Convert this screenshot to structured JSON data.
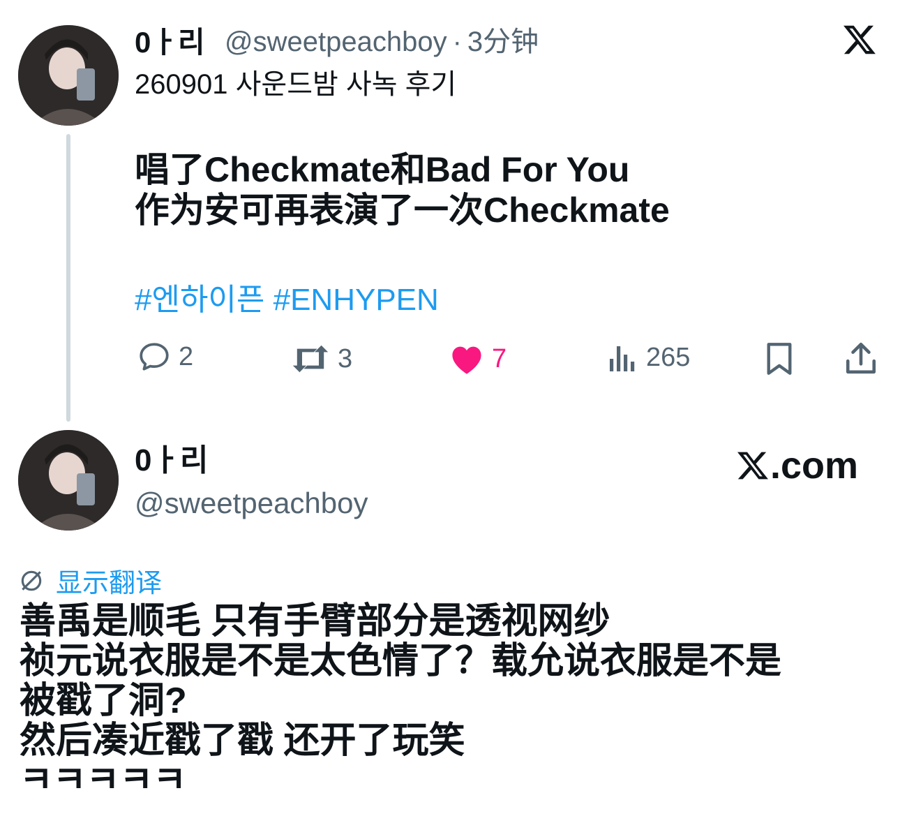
{
  "tweet": {
    "author_name": "0ㅏ리",
    "handle": "@sweetpeachboy",
    "separator": "·",
    "time": "3分钟",
    "text": "260901 사운드밤 사녹 후기",
    "image_text_line1": "唱了Checkmate和Bad For You",
    "image_text_line2": "作为安可再表演了一次Checkmate",
    "hashtags": "#엔하이픈 #ENHYPEN",
    "actions": {
      "reply_count": "2",
      "retweet_count": "3",
      "like_count": "7",
      "views_count": "265"
    }
  },
  "quote_card": {
    "author_name": "0ㅏ리",
    "handle": "@sweetpeachboy",
    "site": ".com",
    "translate_label": "显示翻译",
    "text": "善禹是顺毛 只有手臂部分是透视网纱\n祯元说衣服是不是太色情了？载允说衣服是不是\n被戳了洞?\n然后凑近戳了戳 还开了玩笑\nㅋㅋㅋㅋㅋ"
  },
  "colors": {
    "accent": "#1d9bf0",
    "like": "#f91880",
    "muted": "#536471",
    "thread_line": "#cfd9de"
  },
  "icons": [
    "x-logo-icon",
    "reply-icon",
    "retweet-icon",
    "heart-icon",
    "views-icon",
    "bookmark-icon",
    "share-icon",
    "translate-icon"
  ]
}
